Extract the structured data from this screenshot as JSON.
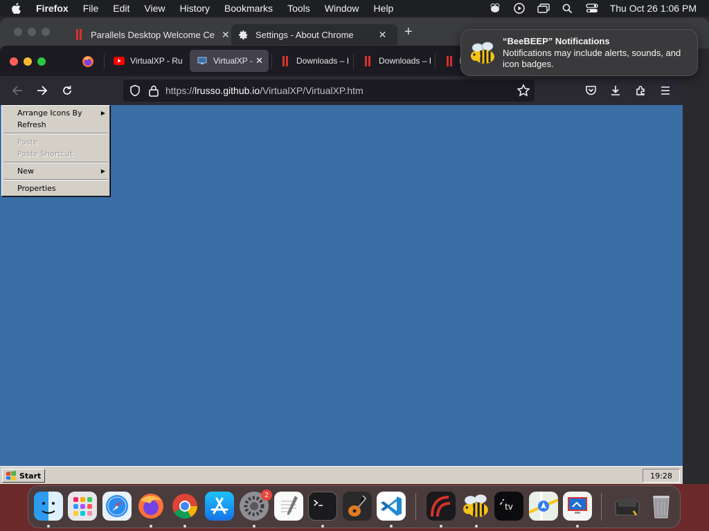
{
  "menubar": {
    "app_name": "Firefox",
    "items": [
      "File",
      "Edit",
      "View",
      "History",
      "Bookmarks",
      "Tools",
      "Window",
      "Help"
    ],
    "clock": "Thu Oct 26  1:06 PM"
  },
  "chrome_window": {
    "tabs": [
      {
        "label": "Parallels Desktop Welcome Ce",
        "close": "✕"
      },
      {
        "label": "Settings - About Chrome",
        "close": "✕"
      }
    ],
    "new_tab": "+"
  },
  "firefox": {
    "tabs": [
      {
        "label": "VirtualXP - Ru"
      },
      {
        "label": "VirtualXP -",
        "close": "✕"
      },
      {
        "label": "Downloads – I"
      },
      {
        "label": "Downloads – I"
      },
      {
        "label": "D"
      }
    ],
    "url_host": "lrusso.github.io",
    "url_prefix": "https://",
    "url_path": "/VirtualXP/VirtualXP.htm"
  },
  "xp": {
    "context_menu": {
      "items": [
        {
          "label": "Arrange Icons By",
          "submenu": "▶"
        },
        {
          "label": "Refresh"
        },
        {
          "label": "Paste"
        },
        {
          "label": "Paste Shortcut"
        },
        {
          "label": "New",
          "submenu": "▶"
        },
        {
          "label": "Properties"
        }
      ]
    },
    "start_label": "Start",
    "tray_time": "19:28",
    "colors": {
      "desktop": "#3a6ea5",
      "taskbar": "#d4d0c8"
    }
  },
  "notification": {
    "title": "“BeeBEEP” Notifications",
    "body": "Notifications may include alerts, sounds, and icon badges."
  },
  "dock": {
    "apps": [
      "finder-icon",
      "launchpad-icon",
      "safari-icon",
      "firefox-icon",
      "chrome-icon",
      "app-store-icon",
      "system-settings-icon",
      "textedit-icon",
      "terminal-icon",
      "garageband-icon",
      "vscode-icon",
      "parallels-icon",
      "beebeep-icon",
      "apple-tv-icon",
      "maps-icon",
      "remote-desktop-icon",
      "downloads-stack-icon",
      "trash-icon"
    ],
    "settings_badge": "2"
  }
}
